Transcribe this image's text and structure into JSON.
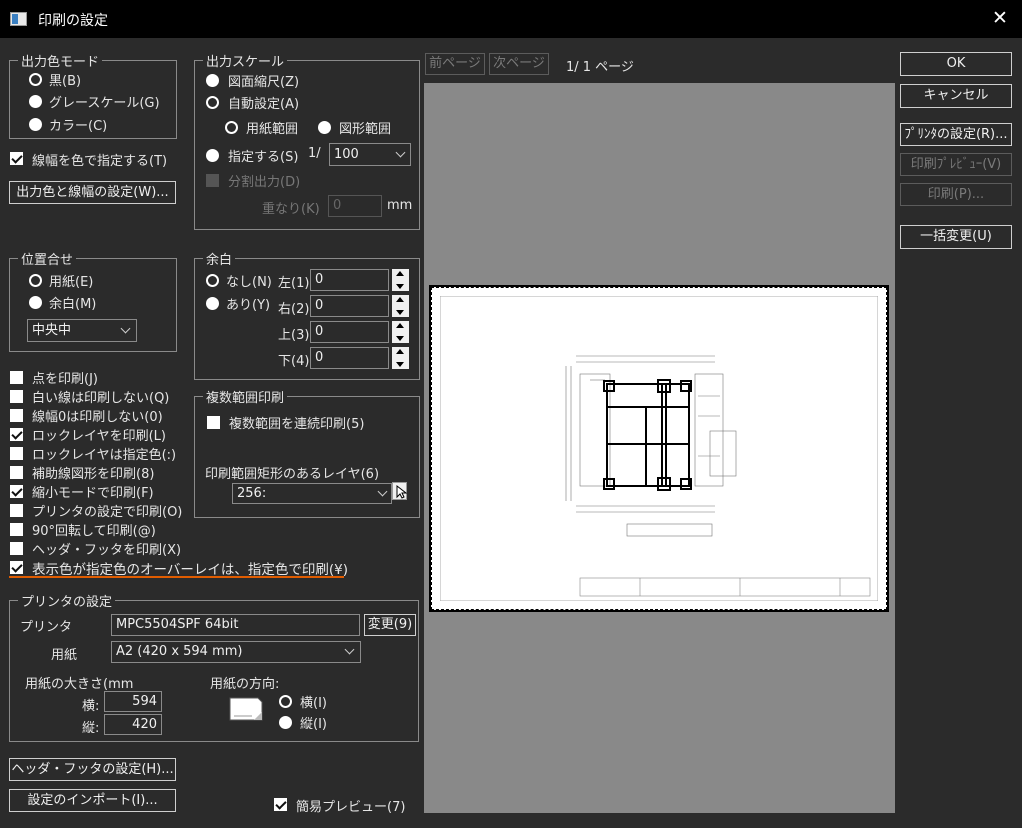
{
  "window": {
    "title": "印刷の設定",
    "close_glyph": "✕"
  },
  "output_color_mode": {
    "legend": "出力色モード",
    "options": [
      "黒(B)",
      "グレースケール(G)",
      "カラー(C)"
    ],
    "selected": 2
  },
  "line_width_by_color": {
    "label": "線幅を色で指定する(T)",
    "checked": true
  },
  "color_width_settings_button": "出力色と線幅の設定(W)...",
  "output_scale": {
    "legend": "出力スケール",
    "drawing_scale": "図面縮尺(Z)",
    "auto": "自動設定(A)",
    "paper_range": "用紙範囲",
    "figure_range": "図形範囲",
    "specify": "指定する(S)",
    "ratio_prefix": "1/",
    "ratio_value": "100",
    "split_output": "分割出力(D)",
    "overlap_label": "重なり(K)",
    "overlap_value": "0",
    "overlap_unit": "mm"
  },
  "alignment": {
    "legend": "位置合せ",
    "paper": "用紙(E)",
    "margin": "余白(M)",
    "position_value": "中央中"
  },
  "margin": {
    "legend": "余白",
    "none": "なし(N)",
    "exists": "あり(Y)",
    "left_label": "左(1)",
    "left_value": "0",
    "right_label": "右(2)",
    "right_value": "0",
    "top_label": "上(3)",
    "top_value": "0",
    "bottom_label": "下(4)",
    "bottom_value": "0"
  },
  "checks": [
    {
      "label": "点を印刷(J)",
      "checked": false
    },
    {
      "label": "白い線は印刷しない(Q)",
      "checked": false
    },
    {
      "label": "線幅0は印刷しない(0)",
      "checked": false
    },
    {
      "label": "ロックレイヤを印刷(L)",
      "checked": true
    },
    {
      "label": "ロックレイヤは指定色(:)",
      "checked": false
    },
    {
      "label": "補助線図形を印刷(8)",
      "checked": false
    },
    {
      "label": "縮小モードで印刷(F)",
      "checked": true
    },
    {
      "label": "プリンタの設定で印刷(O)",
      "checked": false
    },
    {
      "label": "90°回転して印刷(@)",
      "checked": false
    },
    {
      "label": "ヘッダ・フッタを印刷(X)",
      "checked": false
    },
    {
      "label": "表示色が指定色のオーバーレイは、指定色で印刷(¥)",
      "checked": true
    }
  ],
  "multi_range": {
    "legend": "複数範囲印刷",
    "continuous": "複数範囲を連続印刷(5)",
    "layer_label": "印刷範囲矩形のあるレイヤ(6)",
    "layer_value": "256:"
  },
  "printer_settings": {
    "legend": "プリンタの設定",
    "printer_label": "プリンタ",
    "printer_value": "MPC5504SPF 64bit",
    "change_button": "変更(9)",
    "paper_label": "用紙",
    "paper_value": "A2 (420 x 594 mm)",
    "size_label": "用紙の大きさ(mm",
    "width_label": "横:",
    "width_value": "594",
    "height_label": "縦:",
    "height_value": "420",
    "orientation_label": "用紙の方向:",
    "landscape": "横(I)",
    "portrait": "縦(I)"
  },
  "header_footer_button": "ヘッダ・フッタの設定(H)...",
  "import_button": "設定のインポート(I)...",
  "simple_preview": {
    "label": "簡易プレビュー(7)",
    "checked": true
  },
  "pager": {
    "prev": "前ページ",
    "next": "次ページ",
    "page_text": "1/ 1 ページ"
  },
  "right_buttons": {
    "ok": "OK",
    "cancel": "キャンセル",
    "printer_setup": "ﾌﾟﾘﾝﾀの設定(R)...",
    "print_preview": "印刷ﾌﾟﾚﾋﾞｭｰ(V)",
    "print": "印刷(P)...",
    "bulk_change": "一括変更(U)"
  },
  "colors": {
    "bg": "#2b2b2b",
    "titlebar": "#000000",
    "preview_bg": "#898989",
    "highlight_underline": "#e05c00"
  }
}
